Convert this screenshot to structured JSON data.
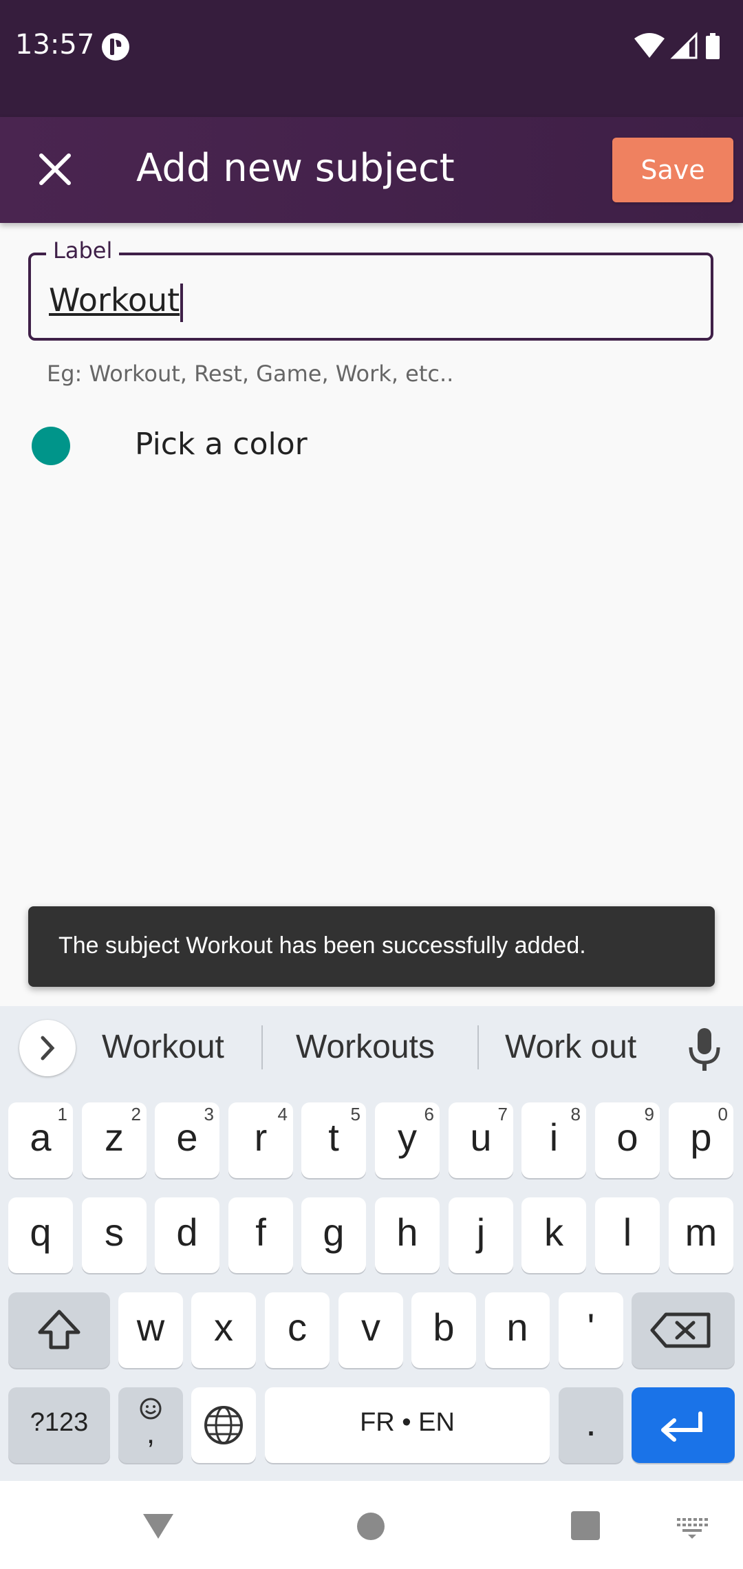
{
  "status_bar": {
    "time": "13:57"
  },
  "app_bar": {
    "title": "Add new subject",
    "close_icon": "close-icon",
    "save_label": "Save"
  },
  "form": {
    "label_legend": "Label",
    "label_value": "Workout",
    "helper_text": "Eg: Workout, Rest, Game, Work, etc..",
    "color_label": "Pick a color",
    "selected_color": "#00958a"
  },
  "snackbar": {
    "message": "The subject Workout has been successfully added."
  },
  "keyboard": {
    "suggestions": [
      "Workout",
      "Workouts",
      "Work out"
    ],
    "row1": [
      {
        "key": "a",
        "hint": "1"
      },
      {
        "key": "z",
        "hint": "2"
      },
      {
        "key": "e",
        "hint": "3"
      },
      {
        "key": "r",
        "hint": "4"
      },
      {
        "key": "t",
        "hint": "5"
      },
      {
        "key": "y",
        "hint": "6"
      },
      {
        "key": "u",
        "hint": "7"
      },
      {
        "key": "i",
        "hint": "8"
      },
      {
        "key": "o",
        "hint": "9"
      },
      {
        "key": "p",
        "hint": "0"
      }
    ],
    "row2": [
      "q",
      "s",
      "d",
      "f",
      "g",
      "h",
      "j",
      "k",
      "l",
      "m"
    ],
    "row3": [
      "w",
      "x",
      "c",
      "v",
      "b",
      "n",
      "'"
    ],
    "symbols_key": "?123",
    "emoji_comma": ",",
    "space_label": "FR • EN",
    "period": "."
  },
  "colors": {
    "status_bar": "#361d3d",
    "app_bar": "#4a2550",
    "save_button": "#ef8160",
    "accent": "#3f2048",
    "enter_key": "#1a73e8"
  }
}
